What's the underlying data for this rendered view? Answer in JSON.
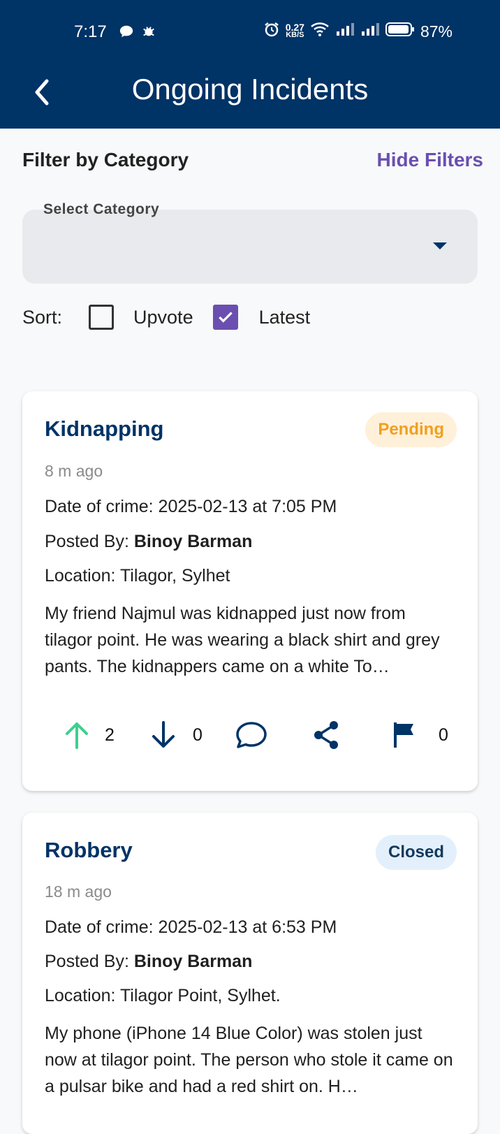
{
  "status_bar": {
    "time": "7:17",
    "net_speed_value": "0.27",
    "net_speed_unit": "KB/S",
    "battery": "87%"
  },
  "app_bar": {
    "title": "Ongoing Incidents",
    "back_icon": "chevron-left-icon"
  },
  "filters": {
    "heading": "Filter by Category",
    "toggle_label": "Hide Filters",
    "select_label": "Select Category",
    "select_value": ""
  },
  "sort": {
    "label": "Sort:",
    "options": [
      {
        "label": "Upvote",
        "checked": false
      },
      {
        "label": "Latest",
        "checked": true
      }
    ]
  },
  "colors": {
    "primary": "#003366",
    "accent": "#6a4fb0",
    "upvote": "#3ecf8e",
    "pending": "#f0a020"
  },
  "incidents": [
    {
      "title": "Kidnapping",
      "status": "Pending",
      "ago": "8 m ago",
      "date_label": "Date of crime: 2025-02-13 at 7:05 PM",
      "posted_by_label": "Posted By:",
      "posted_by": "Binoy Barman",
      "location_label": "Location: Tilagor, Sylhet",
      "description": "My friend Najmul was kidnapped just now from tilagor point. He was wearing a black shirt and grey pants. The kidnappers came on a white To…",
      "upvotes": "2",
      "downvotes": "0",
      "flags": "0"
    },
    {
      "title": "Robbery",
      "status": "Closed",
      "ago": "18 m ago",
      "date_label": "Date of crime: 2025-02-13 at 6:53 PM",
      "posted_by_label": "Posted By:",
      "posted_by": "Binoy Barman",
      "location_label": "Location: Tilagor Point, Sylhet.",
      "description": "My phone (iPhone 14 Blue Color) was stolen just now at tilagor point. The person who stole it came on a pulsar bike and had a red shirt on. H…"
    }
  ]
}
